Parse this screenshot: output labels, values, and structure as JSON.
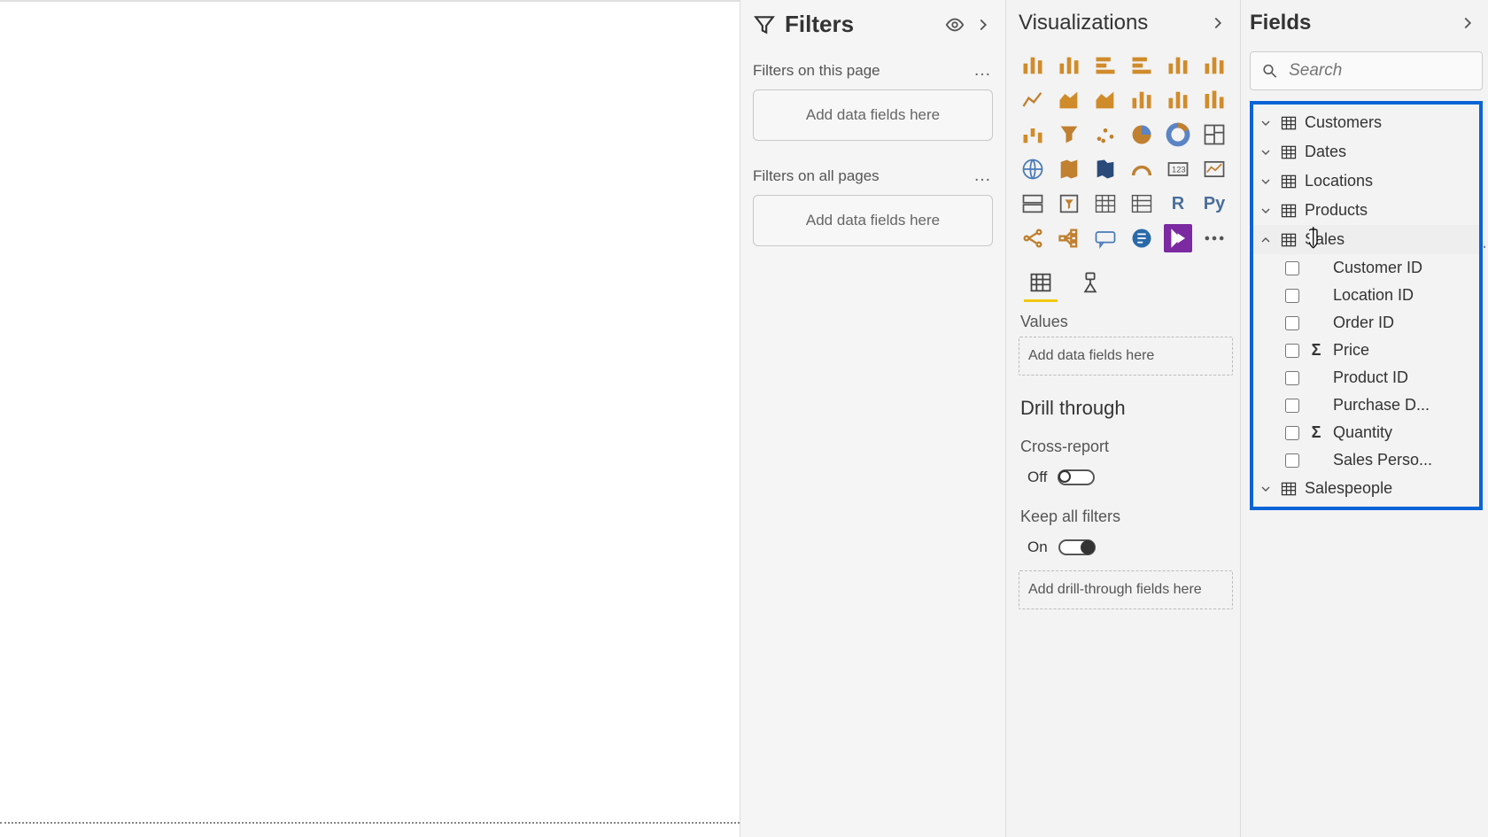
{
  "filters": {
    "title": "Filters",
    "thisPageLabel": "Filters on this page",
    "thisPagePlaceholder": "Add data fields here",
    "allPagesLabel": "Filters on all pages",
    "allPagesPlaceholder": "Add data fields here"
  },
  "viz": {
    "title": "Visualizations",
    "valuesLabel": "Values",
    "valuesPlaceholder": "Add data fields here",
    "drillTitle": "Drill through",
    "crossReportLabel": "Cross-report",
    "crossReportState": "Off",
    "keepFiltersLabel": "Keep all filters",
    "keepFiltersState": "On",
    "drillPlaceholder": "Add drill-through fields here"
  },
  "fields": {
    "title": "Fields",
    "searchPlaceholder": "Search",
    "tables": [
      {
        "name": "Customers",
        "expanded": false
      },
      {
        "name": "Dates",
        "expanded": false
      },
      {
        "name": "Locations",
        "expanded": false
      },
      {
        "name": "Products",
        "expanded": false
      },
      {
        "name": "Sales",
        "expanded": true,
        "fields": [
          {
            "name": "Customer ID",
            "sigma": false
          },
          {
            "name": "Location ID",
            "sigma": false
          },
          {
            "name": "Order ID",
            "sigma": false
          },
          {
            "name": "Price",
            "sigma": true
          },
          {
            "name": "Product ID",
            "sigma": false
          },
          {
            "name": "Purchase D...",
            "sigma": false
          },
          {
            "name": "Quantity",
            "sigma": true
          },
          {
            "name": "Sales Perso...",
            "sigma": false
          }
        ]
      },
      {
        "name": "Salespeople",
        "expanded": false
      }
    ]
  },
  "vizIcons": [
    "stacked-bar",
    "clustered-bar",
    "stacked-bar-h",
    "clustered-bar-h",
    "stacked100-bar",
    "stacked100-col",
    "line",
    "area",
    "stacked-area",
    "line-col",
    "line-col2",
    "ribbon",
    "waterfall",
    "funnel",
    "scatter",
    "pie",
    "donut",
    "treemap",
    "map",
    "filled-map",
    "shape-map",
    "gauge",
    "card",
    "kpi",
    "multi-card",
    "slicer",
    "table",
    "matrix",
    "r",
    "py",
    "key-influencers",
    "decomp",
    "qa",
    "narrative",
    "powerapps",
    "more"
  ]
}
